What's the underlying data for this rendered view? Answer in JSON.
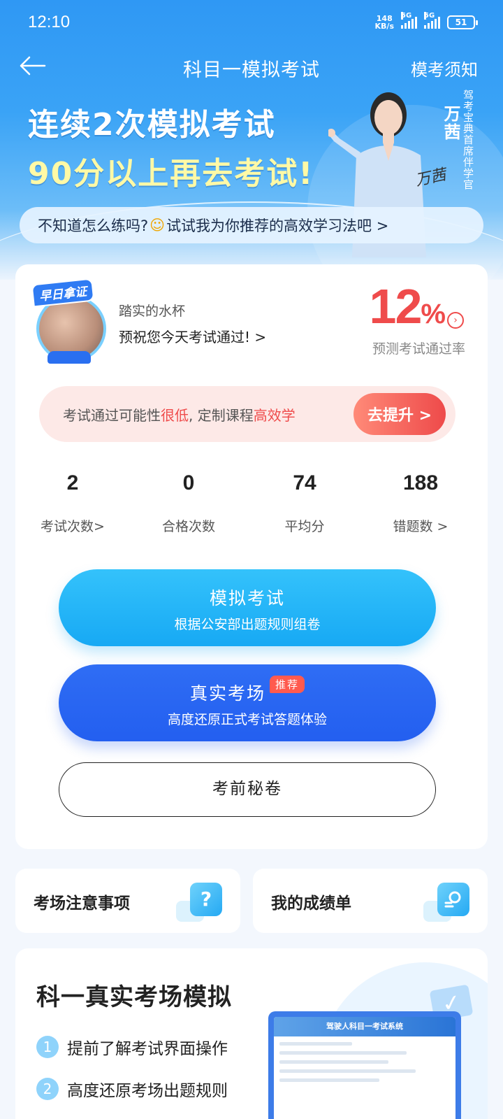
{
  "status_bar": {
    "time": "12:10",
    "net_speed_value": "148",
    "net_speed_unit": "KB/s",
    "sim1": "5G",
    "sim2": "5G",
    "battery": "51"
  },
  "nav": {
    "title": "科目一模拟考试",
    "right_link": "模考须知"
  },
  "banner": {
    "line1": "连续2次模拟考试",
    "line2": "90分以上再去考试!",
    "person_name": "万茜",
    "person_role": "驾考宝典首席伴学官",
    "signature": "万茜",
    "tip_prefix": "不知道怎么练吗?",
    "tip_emoji": "☺",
    "tip_suffix": "试试我为你推荐的高效学习法吧 >"
  },
  "profile": {
    "badge": "早日拿证",
    "user_name": "踏实的水杯",
    "wish": "预祝您今天考试通过! >",
    "pass_rate_value": "12",
    "pass_rate_unit": "%",
    "pass_rate_label": "预测考试通过率"
  },
  "promo": {
    "text1": "考试通过可能性",
    "text_red1": "很低",
    "text2": ", 定制课程",
    "text_red2": "高效学",
    "button": "去提升 >"
  },
  "stats": [
    {
      "value": "2",
      "label": "考试次数>"
    },
    {
      "value": "0",
      "label": "合格次数"
    },
    {
      "value": "74",
      "label": "平均分"
    },
    {
      "value": "188",
      "label": "错题数 >"
    }
  ],
  "actions": {
    "simulate_title": "模拟考试",
    "simulate_sub": "根据公安部出题规则组卷",
    "real_title": "真实考场",
    "real_tag": "推荐",
    "real_sub": "高度还原正式考试答题体验",
    "secret": "考前秘卷"
  },
  "mini_cards": [
    {
      "label": "考场注意事项",
      "icon": "question-icon"
    },
    {
      "label": "我的成绩单",
      "icon": "search-report-icon"
    }
  ],
  "feature": {
    "title": "科一真实考场模拟",
    "items": [
      {
        "num": "1",
        "text": "提前了解考试界面操作"
      },
      {
        "num": "2",
        "text": "高度还原考场出题规则"
      }
    ],
    "screen_header": "驾驶人科目一考试系统"
  },
  "colors": {
    "brand_blue": "#2f98f4",
    "accent_red": "#ef4b4b",
    "sim_button": "#17a9f4",
    "real_button": "#235ff0"
  }
}
